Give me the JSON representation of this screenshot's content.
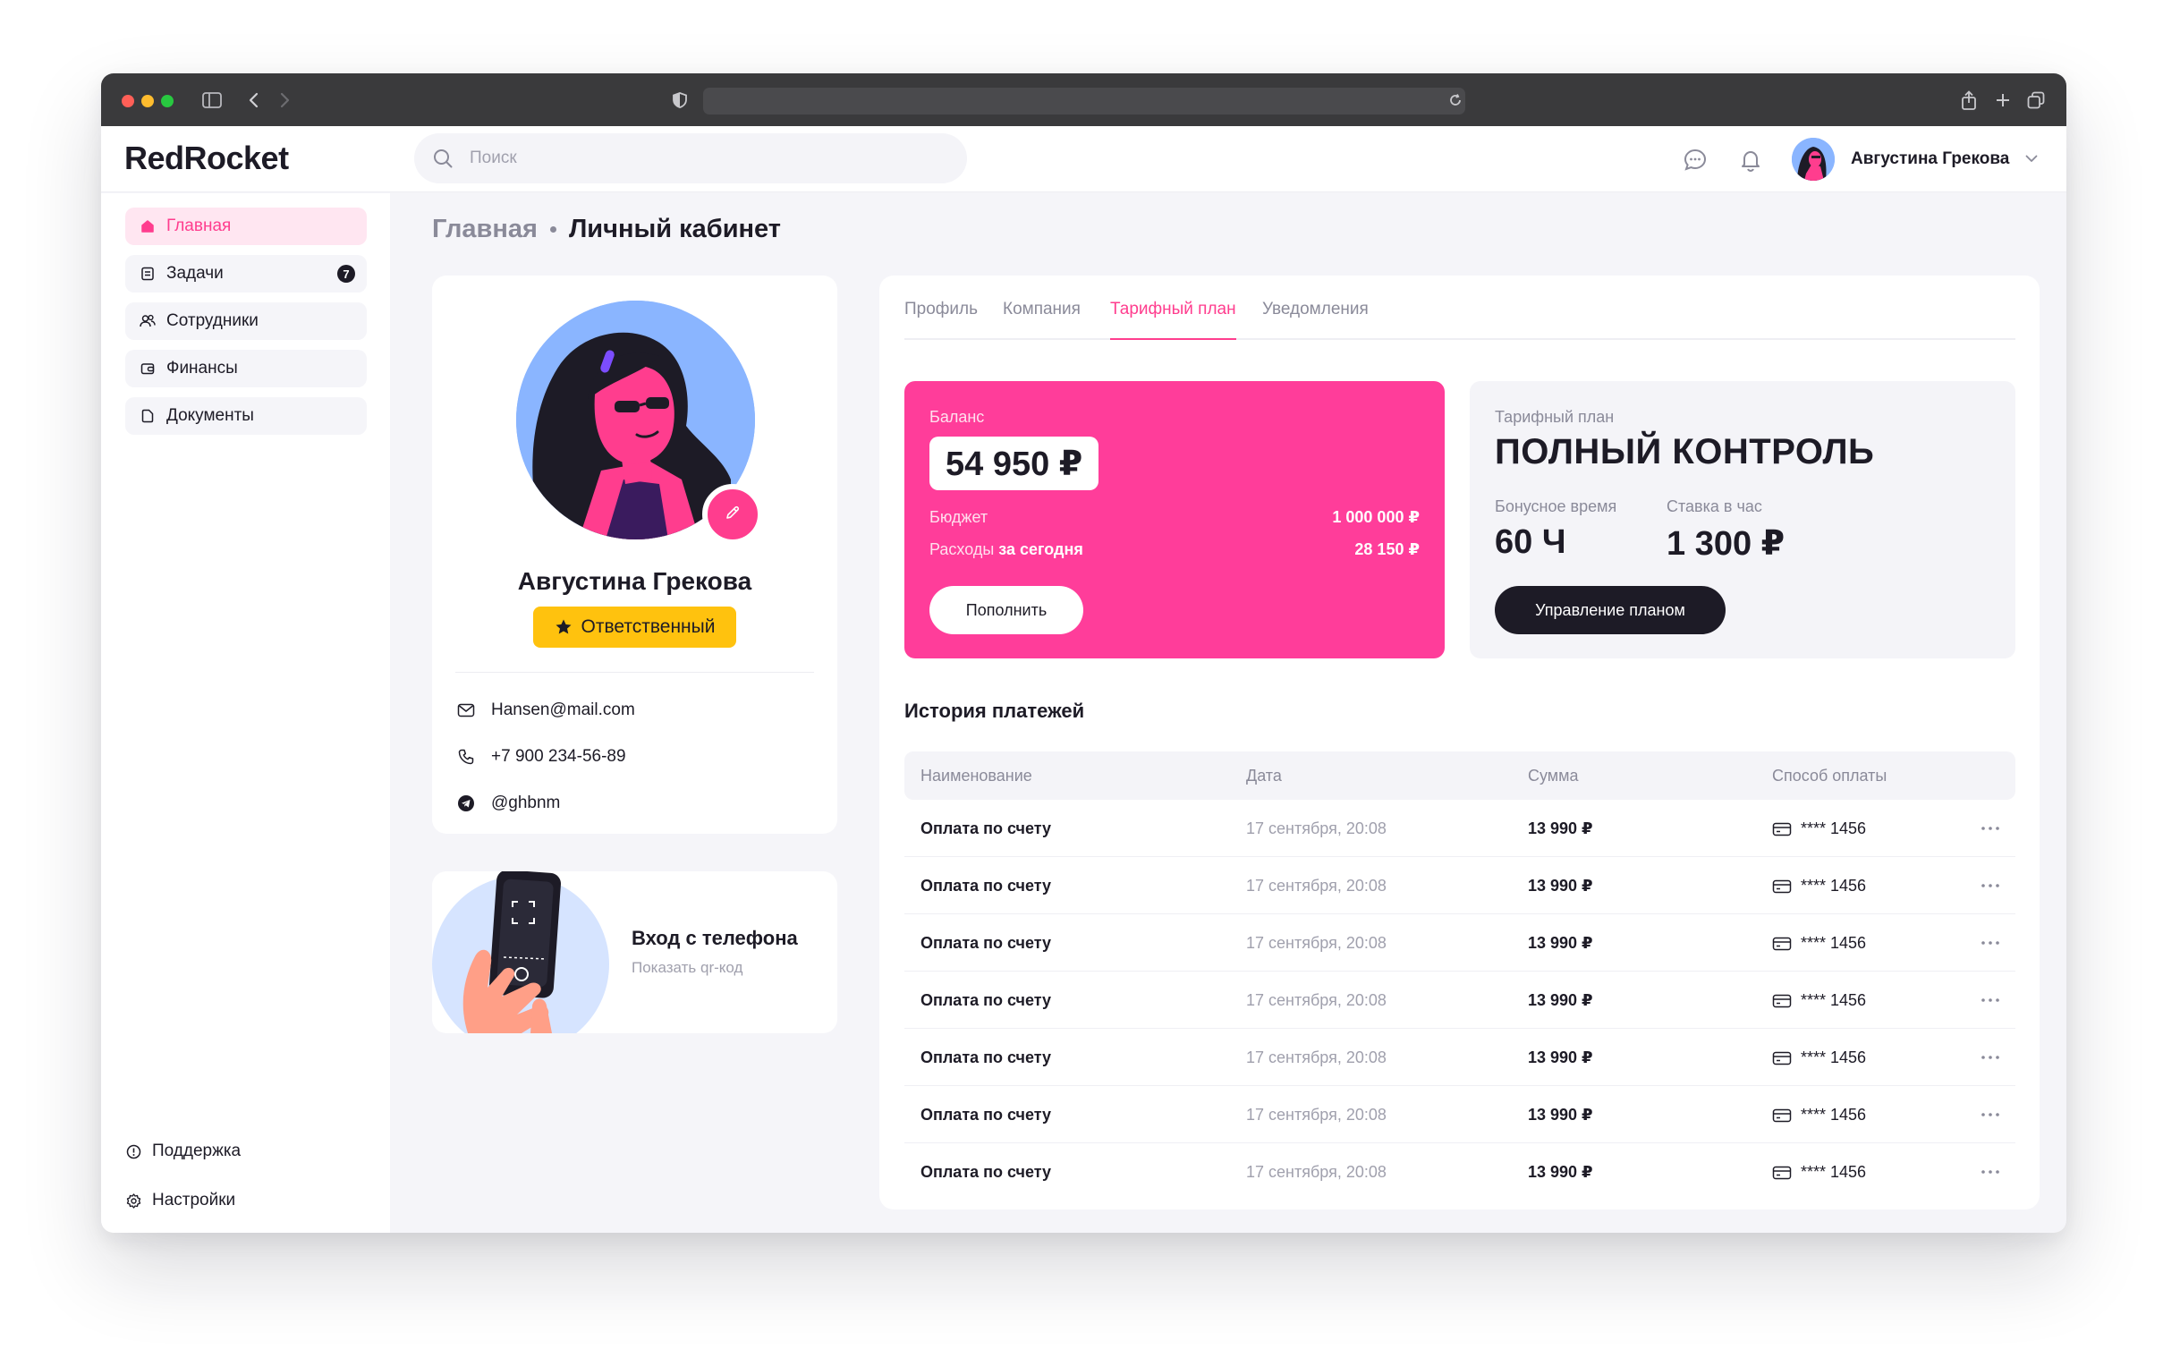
{
  "app": {
    "logo": "RedRocket"
  },
  "header": {
    "search_placeholder": "Поиск",
    "user_name": "Августина Грекова"
  },
  "sidebar": {
    "items": [
      {
        "label": "Главная",
        "icon": "home-icon",
        "active": true
      },
      {
        "label": "Задачи",
        "icon": "tasks-icon",
        "badge": "7"
      },
      {
        "label": "Сотрудники",
        "icon": "users-icon"
      },
      {
        "label": "Финансы",
        "icon": "wallet-icon"
      },
      {
        "label": "Документы",
        "icon": "document-icon"
      }
    ],
    "bottom": [
      {
        "label": "Поддержка",
        "icon": "help-icon"
      },
      {
        "label": "Настройки",
        "icon": "settings-icon"
      }
    ]
  },
  "breadcrumb": {
    "parent": "Главная",
    "current": "Личный кабинет"
  },
  "profile": {
    "name": "Августина Грекова",
    "role": "Ответственный",
    "email": "Hansen@mail.com",
    "phone": "+7 900 234-56-89",
    "telegram": "@ghbnm"
  },
  "phone_login": {
    "title": "Вход с телефона",
    "subtitle": "Показать qr-код"
  },
  "tabs": [
    {
      "label": "Профиль"
    },
    {
      "label": "Компания"
    },
    {
      "label": "Тарифный план",
      "active": true
    },
    {
      "label": "Уведомления"
    }
  ],
  "balance": {
    "label": "Баланс",
    "amount": "54 950 ₽",
    "budget_label": "Бюджет",
    "budget_value": "1 000 000 ₽",
    "expenses_label": "Расходы",
    "expenses_period": "за сегодня",
    "expenses_value": "28 150 ₽",
    "topup_label": "Пополнить"
  },
  "plan": {
    "label": "Тарифный план",
    "name": "ПОЛНЫЙ КОНТРОЛЬ",
    "bonus_label": "Бонусное время",
    "bonus_value": "60 Ч",
    "rate_label": "Ставка в час",
    "rate_value": "1 300 ₽",
    "manage_label": "Управление планом"
  },
  "history": {
    "title": "История платежей",
    "columns": [
      "Наименование",
      "Дата",
      "Сумма",
      "Способ оплаты"
    ],
    "rows": [
      {
        "name": "Оплата по счету",
        "date": "17 сентября, 20:08",
        "sum": "13 990 ₽",
        "card": "**** 1456"
      },
      {
        "name": "Оплата по счету",
        "date": "17 сентября, 20:08",
        "sum": "13 990 ₽",
        "card": "**** 1456"
      },
      {
        "name": "Оплата по счету",
        "date": "17 сентября, 20:08",
        "sum": "13 990 ₽",
        "card": "**** 1456"
      },
      {
        "name": "Оплата по счету",
        "date": "17 сентября, 20:08",
        "sum": "13 990 ₽",
        "card": "**** 1456"
      },
      {
        "name": "Оплата по счету",
        "date": "17 сентября, 20:08",
        "sum": "13 990 ₽",
        "card": "**** 1456"
      },
      {
        "name": "Оплата по счету",
        "date": "17 сентября, 20:08",
        "sum": "13 990 ₽",
        "card": "**** 1456"
      },
      {
        "name": "Оплата по счету",
        "date": "17 сентября, 20:08",
        "sum": "13 990 ₽",
        "card": "**** 1456"
      }
    ]
  },
  "colors": {
    "accent": "#ff3d8e",
    "balance_card": "#ff3d9a",
    "role_badge": "#ffc20e",
    "dark": "#1d1b26"
  }
}
